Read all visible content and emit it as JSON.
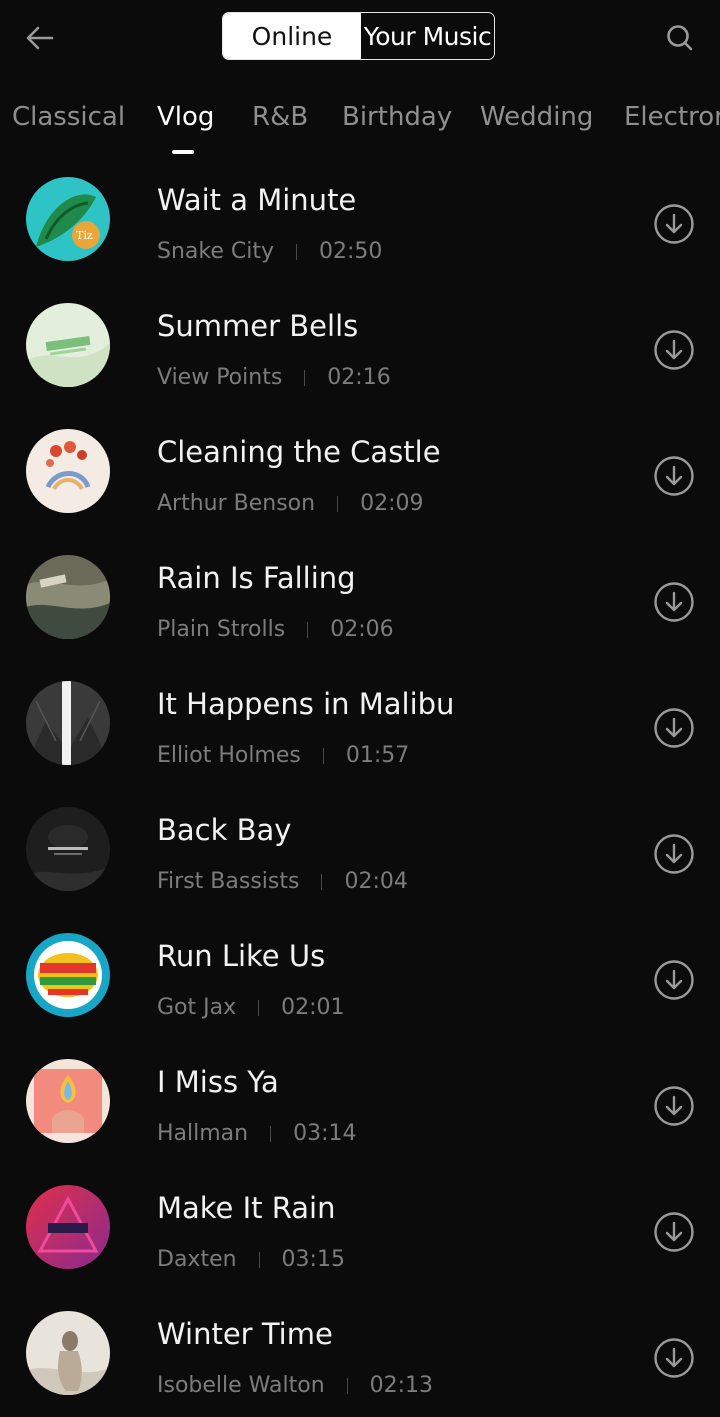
{
  "header": {
    "back_icon": "arrow-left-icon",
    "search_icon": "search-icon",
    "segments": [
      {
        "label": "Online",
        "selected": true
      },
      {
        "label": "Your Music",
        "selected": false
      }
    ]
  },
  "genres": [
    {
      "label": "Classical",
      "active": false
    },
    {
      "label": "Vlog",
      "active": true
    },
    {
      "label": "R&B",
      "active": false
    },
    {
      "label": "Birthday",
      "active": false
    },
    {
      "label": "Wedding",
      "active": false
    },
    {
      "label": "Electror",
      "active": false
    }
  ],
  "tracks": [
    {
      "title": "Wait a Minute",
      "artist": "Snake City",
      "duration": "02:50"
    },
    {
      "title": "Summer Bells",
      "artist": "View Points",
      "duration": "02:16"
    },
    {
      "title": "Cleaning the Castle",
      "artist": "Arthur Benson",
      "duration": "02:09"
    },
    {
      "title": "Rain Is Falling",
      "artist": "Plain Strolls",
      "duration": "02:06"
    },
    {
      "title": "It Happens in Malibu",
      "artist": "Elliot Holmes",
      "duration": "01:57"
    },
    {
      "title": "Back Bay",
      "artist": "First Bassists",
      "duration": "02:04"
    },
    {
      "title": "Run Like Us",
      "artist": "Got Jax",
      "duration": "02:01"
    },
    {
      "title": "I Miss Ya",
      "artist": "Hallman",
      "duration": "03:14"
    },
    {
      "title": "Make It Rain",
      "artist": "Daxten",
      "duration": "03:15"
    },
    {
      "title": "Winter Time",
      "artist": "Isobelle Walton",
      "duration": "02:13"
    }
  ],
  "colors": {
    "background": "#0b0b0b",
    "title_text": "#f2f2f2",
    "meta_text": "#7c7c7c",
    "inactive_tab": "#8f8f8f",
    "icon": "#9a9a9a"
  }
}
